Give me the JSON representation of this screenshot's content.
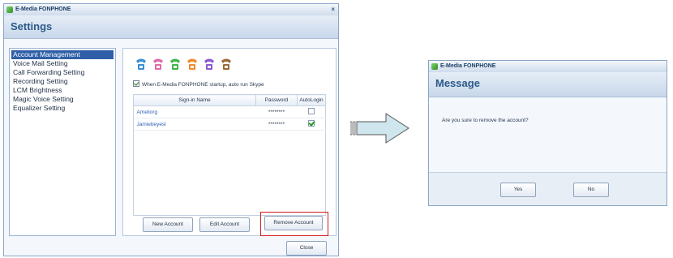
{
  "settings_window": {
    "title": "E-Media FONPHONE",
    "close_glyph": "×",
    "header": "Settings",
    "sidebar_items": [
      {
        "label": "Account Management",
        "selected": true
      },
      {
        "label": "Voice Mail Setting",
        "selected": false
      },
      {
        "label": "Call Forwarding Setting",
        "selected": false
      },
      {
        "label": "Recording Setting",
        "selected": false
      },
      {
        "label": "LCM Brightness",
        "selected": false
      },
      {
        "label": "Magic Voice Setting",
        "selected": false
      },
      {
        "label": "Equalizer Setting",
        "selected": false
      }
    ],
    "status_icons": [
      "phone-blue-icon",
      "phone-pink-icon",
      "phone-green-icon",
      "phone-orange-icon",
      "phone-purple-icon",
      "phone-brown-icon"
    ],
    "startup_checkbox_label": "When E-Media FONPHONE startup, auto run Skype",
    "table": {
      "headers": [
        "Sign-in Name",
        "Password",
        "AutoLogin"
      ],
      "rows": [
        {
          "name": "Ameliorg",
          "password": "********",
          "autologin": false
        },
        {
          "name": "Jamiebeyesl",
          "password": "********",
          "autologin": true
        }
      ]
    },
    "buttons": {
      "new_account": "New Account",
      "edit_account": "Edit Account",
      "remove_account": "Remove Account",
      "close": "Close"
    },
    "highlight_color": "#d11c1c"
  },
  "message_window": {
    "title": "E-Media FONPHONE",
    "header": "Message",
    "text": "Are you sure to remove the account?",
    "buttons": {
      "yes": "Yes",
      "no": "No"
    }
  },
  "colors": {
    "accent": "#2f5fa7",
    "arrow_fill": "#cfe6ee"
  }
}
